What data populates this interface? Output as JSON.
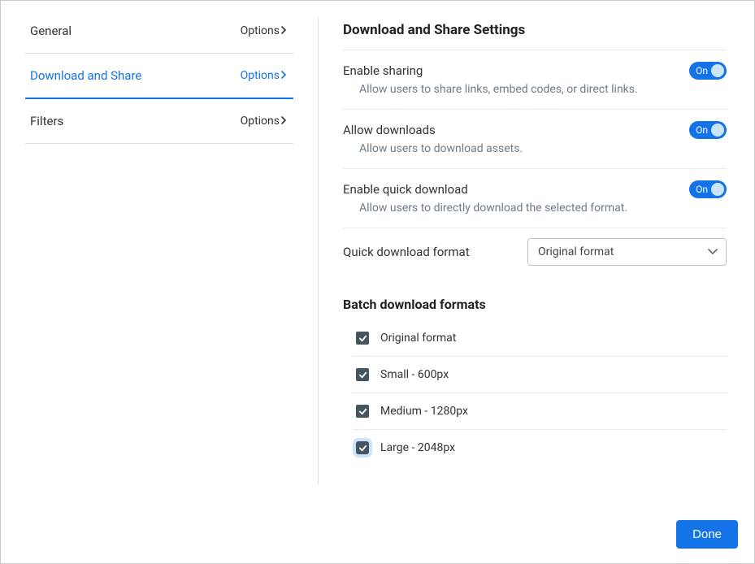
{
  "sidebar": {
    "items": [
      {
        "label": "General",
        "action": "Options",
        "active": false
      },
      {
        "label": "Download and Share",
        "action": "Options",
        "active": true
      },
      {
        "label": "Filters",
        "action": "Options",
        "active": false
      }
    ]
  },
  "content": {
    "heading": "Download and Share Settings",
    "settings": [
      {
        "title": "Enable sharing",
        "description": "Allow users to share links, embed codes, or direct links.",
        "toggle_label": "On",
        "enabled": true
      },
      {
        "title": "Allow downloads",
        "description": "Allow users to download assets.",
        "toggle_label": "On",
        "enabled": true
      },
      {
        "title": "Enable quick download",
        "description": "Allow users to directly download the selected format.",
        "toggle_label": "On",
        "enabled": true
      }
    ],
    "quick_download": {
      "label": "Quick download format",
      "selected": "Original format"
    },
    "batch": {
      "heading": "Batch download formats",
      "items": [
        {
          "label": "Original format",
          "checked": true,
          "focused": false
        },
        {
          "label": "Small - 600px",
          "checked": true,
          "focused": false
        },
        {
          "label": "Medium - 1280px",
          "checked": true,
          "focused": false
        },
        {
          "label": "Large - 2048px",
          "checked": true,
          "focused": true
        }
      ]
    }
  },
  "footer": {
    "done_label": "Done"
  }
}
